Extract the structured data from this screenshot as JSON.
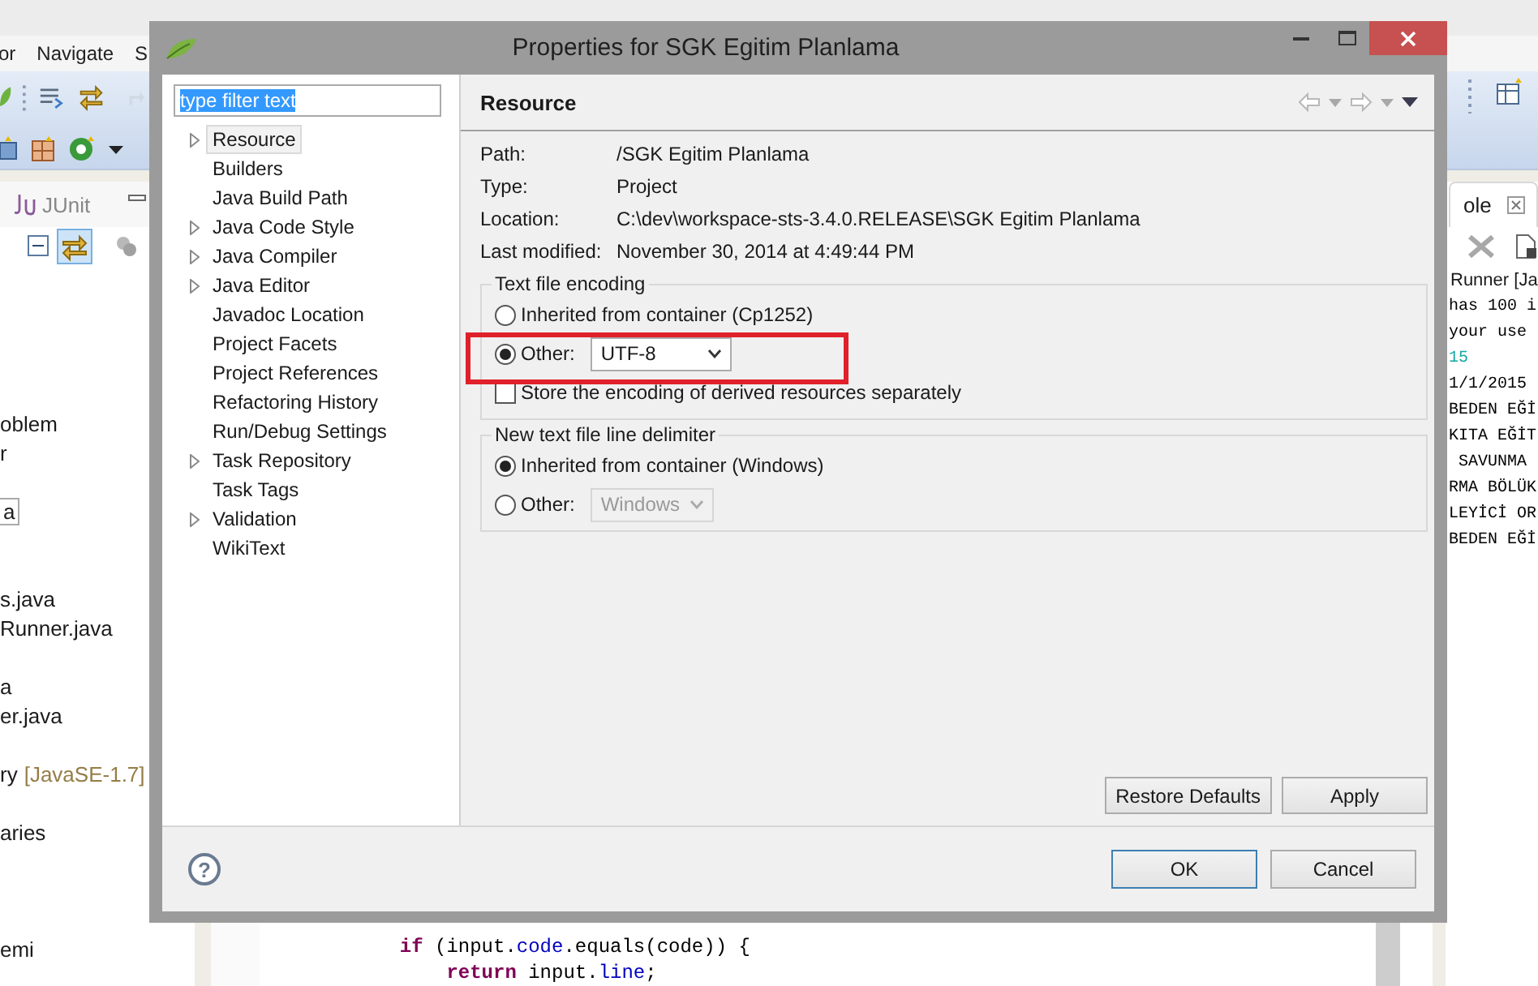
{
  "ide": {
    "menu": [
      "or",
      "Navigate",
      "S"
    ],
    "left_view": {
      "tab": "JUnit",
      "items": [
        {
          "text": "oblem",
          "kind": "plain"
        },
        {
          "text": "r",
          "kind": "plain"
        },
        {
          "text": "a",
          "kind": "boxed"
        },
        {
          "text": "s.java",
          "kind": "plain"
        },
        {
          "text": "Runner.java",
          "kind": "plain"
        },
        {
          "text": "a",
          "kind": "plain"
        },
        {
          "text": "er.java",
          "kind": "plain"
        },
        {
          "text": "ry",
          "kind": "plain",
          "decoration": "[JavaSE-1.7]"
        },
        {
          "text": "aries",
          "kind": "plain"
        },
        {
          "text": "emi",
          "kind": "plain"
        }
      ]
    },
    "console": {
      "tab": "ole",
      "launch": "Runner [Ja",
      "lines": [
        {
          "text": "has 100 i",
          "kind": "plain"
        },
        {
          "text": "your use",
          "kind": "plain"
        },
        {
          "text": "15",
          "kind": "info"
        },
        {
          "text": "1/1/2015",
          "kind": "plain"
        },
        {
          "text": "BEDEN EĞİ",
          "kind": "plain"
        },
        {
          "text": "KITA EĞİT",
          "kind": "plain"
        },
        {
          "text": " SAVUNMA",
          "kind": "plain"
        },
        {
          "text": "RMA BÖLÜK",
          "kind": "plain"
        },
        {
          "text": "LEYİCİ OR",
          "kind": "plain"
        },
        {
          "text": "BEDEN EĞİ",
          "kind": "plain"
        }
      ]
    },
    "editor_lines": [
      {
        "tokens": [
          {
            "text": "if",
            "kind": "keyword"
          },
          {
            "text": " (input.",
            "kind": "plain"
          },
          {
            "text": "code",
            "kind": "field"
          },
          {
            "text": ".equals(code)) {",
            "kind": "plain"
          }
        ],
        "children": [
          {
            "tokens": [
              {
                "text": "return",
                "kind": "keyword"
              },
              {
                "text": " input.",
                "kind": "plain"
              },
              {
                "text": "line",
                "kind": "field"
              },
              {
                "text": ";",
                "kind": "plain"
              }
            ]
          }
        ]
      }
    ]
  },
  "dialog": {
    "title": "Properties for SGK Egitim Planlama",
    "filter": {
      "value": "type filter text",
      "text_selected": true
    },
    "tree": [
      {
        "label": "Resource",
        "expandable": true,
        "selected": true
      },
      {
        "label": "Builders",
        "expandable": false,
        "selected": false
      },
      {
        "label": "Java Build Path",
        "expandable": false,
        "selected": false
      },
      {
        "label": "Java Code Style",
        "expandable": true,
        "selected": false
      },
      {
        "label": "Java Compiler",
        "expandable": true,
        "selected": false
      },
      {
        "label": "Java Editor",
        "expandable": true,
        "selected": false
      },
      {
        "label": "Javadoc Location",
        "expandable": false,
        "selected": false
      },
      {
        "label": "Project Facets",
        "expandable": false,
        "selected": false
      },
      {
        "label": "Project References",
        "expandable": false,
        "selected": false
      },
      {
        "label": "Refactoring History",
        "expandable": false,
        "selected": false
      },
      {
        "label": "Run/Debug Settings",
        "expandable": false,
        "selected": false
      },
      {
        "label": "Task Repository",
        "expandable": true,
        "selected": false
      },
      {
        "label": "Task Tags",
        "expandable": false,
        "selected": false
      },
      {
        "label": "Validation",
        "expandable": true,
        "selected": false
      },
      {
        "label": "WikiText",
        "expandable": false,
        "selected": false
      }
    ],
    "page": {
      "title": "Resource",
      "info": [
        {
          "label": "Path:",
          "value": "/SGK Egitim Planlama"
        },
        {
          "label": "Type:",
          "value": "Project"
        },
        {
          "label": "Location:",
          "value": "C:\\dev\\workspace-sts-3.4.0.RELEASE\\SGK Egitim Planlama"
        },
        {
          "label": "Last modified:",
          "value": "November 30, 2014 at 4:49:44 PM"
        }
      ],
      "groups": [
        {
          "legend": "Text file encoding",
          "options": [
            {
              "label": "Inherited from container (Cp1252)",
              "selected": false,
              "highlighted": false
            },
            {
              "label": "Other:",
              "selected": true,
              "highlighted": true,
              "combo": {
                "value": "UTF-8",
                "disabled": false
              }
            }
          ],
          "checkbox": {
            "label": "Store the encoding of derived resources separately",
            "checked": false
          }
        },
        {
          "legend": "New text file line delimiter",
          "options": [
            {
              "label": "Inherited from container (Windows)",
              "selected": true,
              "highlighted": false
            },
            {
              "label": "Other:",
              "selected": false,
              "highlighted": false,
              "combo": {
                "value": "Windows",
                "disabled": true
              }
            }
          ]
        }
      ],
      "buttons": [
        "Restore Defaults",
        "Apply"
      ]
    },
    "help": "?",
    "buttons": [
      {
        "label": "OK",
        "default": true
      },
      {
        "label": "Cancel",
        "default": false
      }
    ]
  }
}
